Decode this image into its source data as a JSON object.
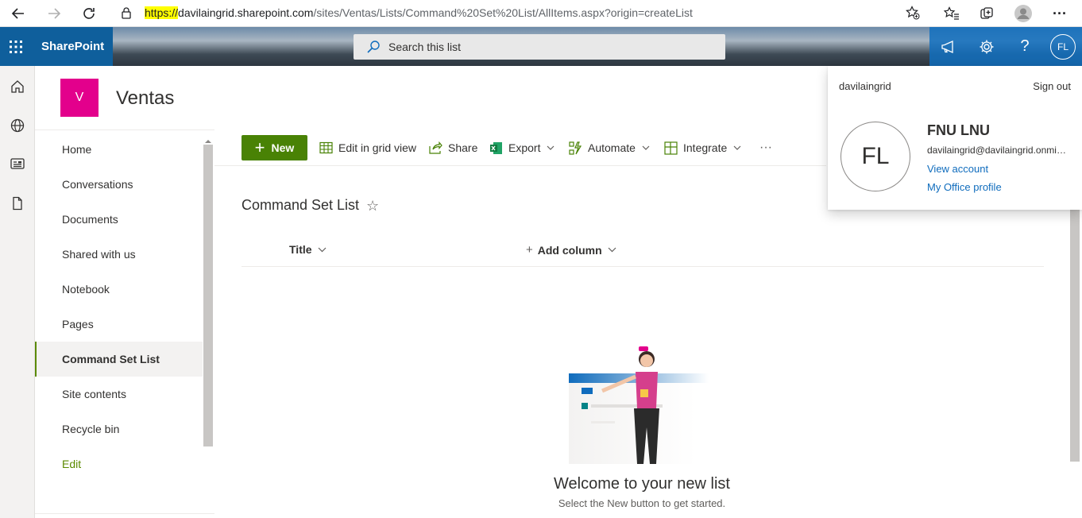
{
  "browser": {
    "url_scheme": "https://",
    "url_host": "davilaingrid.sharepoint.com",
    "url_path": "/sites/Ventas/Lists/Command%20Set%20List/AllItems.aspx?origin=createList"
  },
  "suite": {
    "app_name": "SharePoint",
    "search_placeholder": "Search this list",
    "avatar_initials": "FL",
    "help_label": "?"
  },
  "site": {
    "logo_letter": "V",
    "title": "Ventas"
  },
  "nav": {
    "items": [
      {
        "label": "Home"
      },
      {
        "label": "Conversations"
      },
      {
        "label": "Documents"
      },
      {
        "label": "Shared with us"
      },
      {
        "label": "Notebook"
      },
      {
        "label": "Pages"
      },
      {
        "label": "Command Set List",
        "selected": true
      },
      {
        "label": "Site contents"
      },
      {
        "label": "Recycle bin"
      },
      {
        "label": "Edit"
      }
    ]
  },
  "command_bar": {
    "new_label": "New",
    "edit_grid_label": "Edit in grid view",
    "share_label": "Share",
    "export_label": "Export",
    "automate_label": "Automate",
    "integrate_label": "Integrate",
    "more_label": "···"
  },
  "list": {
    "title": "Command Set List",
    "columns": [
      "Title",
      "Add column"
    ],
    "empty_title": "Welcome to your new list",
    "empty_subtitle": "Select the New button to get started."
  },
  "account": {
    "tenant": "davilaingrid",
    "sign_out": "Sign out",
    "initials": "FL",
    "name": "FNU LNU",
    "email": "davilaingrid@davilaingrid.onmicrosoft.com",
    "view_account": "View account",
    "office_profile": "My Office profile"
  },
  "colors": {
    "accent_green": "#498205",
    "site_logo": "#e3008c",
    "link_blue": "#0f6cbd"
  }
}
